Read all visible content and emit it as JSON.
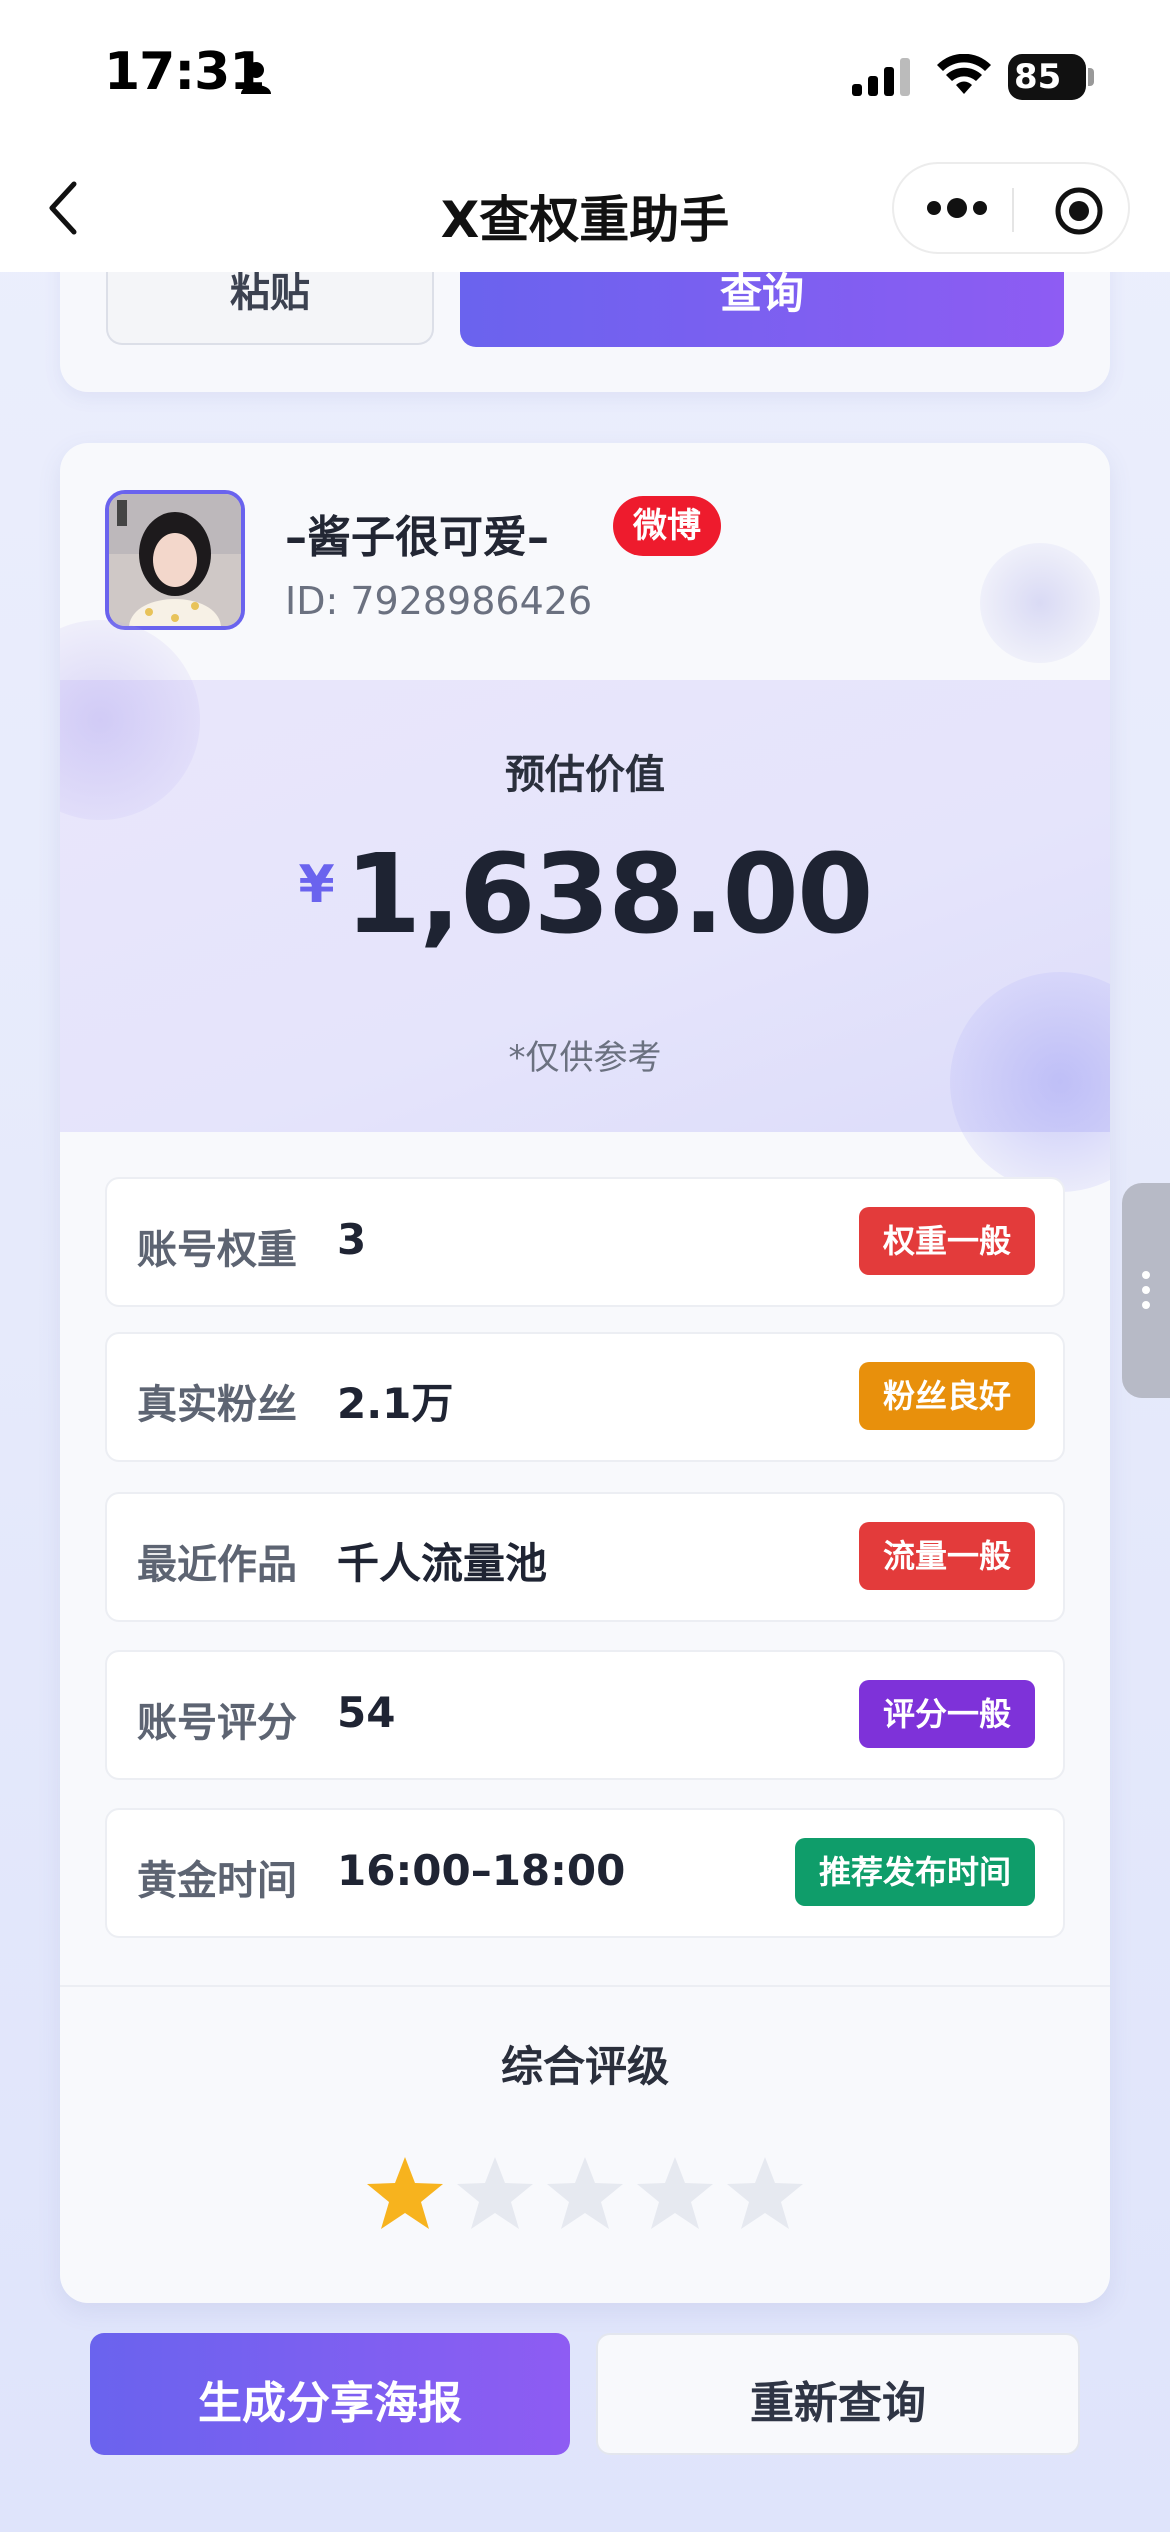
{
  "status_bar": {
    "time": "17:31",
    "battery": "85"
  },
  "nav": {
    "title": "X查权重助手",
    "back_icon": "chevron-left-icon",
    "more_icon": "more-dots-icon",
    "close_icon": "target-circle-icon"
  },
  "query_card": {
    "paste_label": "粘贴",
    "query_label": "查询"
  },
  "profile": {
    "nickname": "–酱子很可爱–",
    "platform": "微博",
    "id": "ID: 7928986426"
  },
  "valuation": {
    "label": "预估价值",
    "currency": "¥",
    "amount": "1,638.00",
    "note": "*仅供参考"
  },
  "stats": [
    {
      "key": "账号权重",
      "value": "3",
      "tag": "权重一般",
      "tag_color": "#e33b3b"
    },
    {
      "key": "真实粉丝",
      "value": "2.1万",
      "tag": "粉丝良好",
      "tag_color": "#e8900c"
    },
    {
      "key": "最近作品",
      "value": "千人流量池",
      "tag": "流量一般",
      "tag_color": "#e33b3b"
    },
    {
      "key": "账号评分",
      "value": "54",
      "tag": "评分一般",
      "tag_color": "#7e32d9"
    },
    {
      "key": "黄金时间",
      "value": "16:00–18:00",
      "tag": "推荐发布时间",
      "tag_color": "#0f9d6a"
    }
  ],
  "rating": {
    "title": "综合评级",
    "stars_filled": 1,
    "stars_total": 5,
    "filled_color": "#f7b31e",
    "empty_color": "#e6e9f0"
  },
  "actions": {
    "share_label": "生成分享海报",
    "requery_label": "重新查询"
  },
  "colors": {
    "accent": "#6a63ee",
    "accent_end": "#8e5cf3",
    "platform_red": "#ee1b2d"
  }
}
